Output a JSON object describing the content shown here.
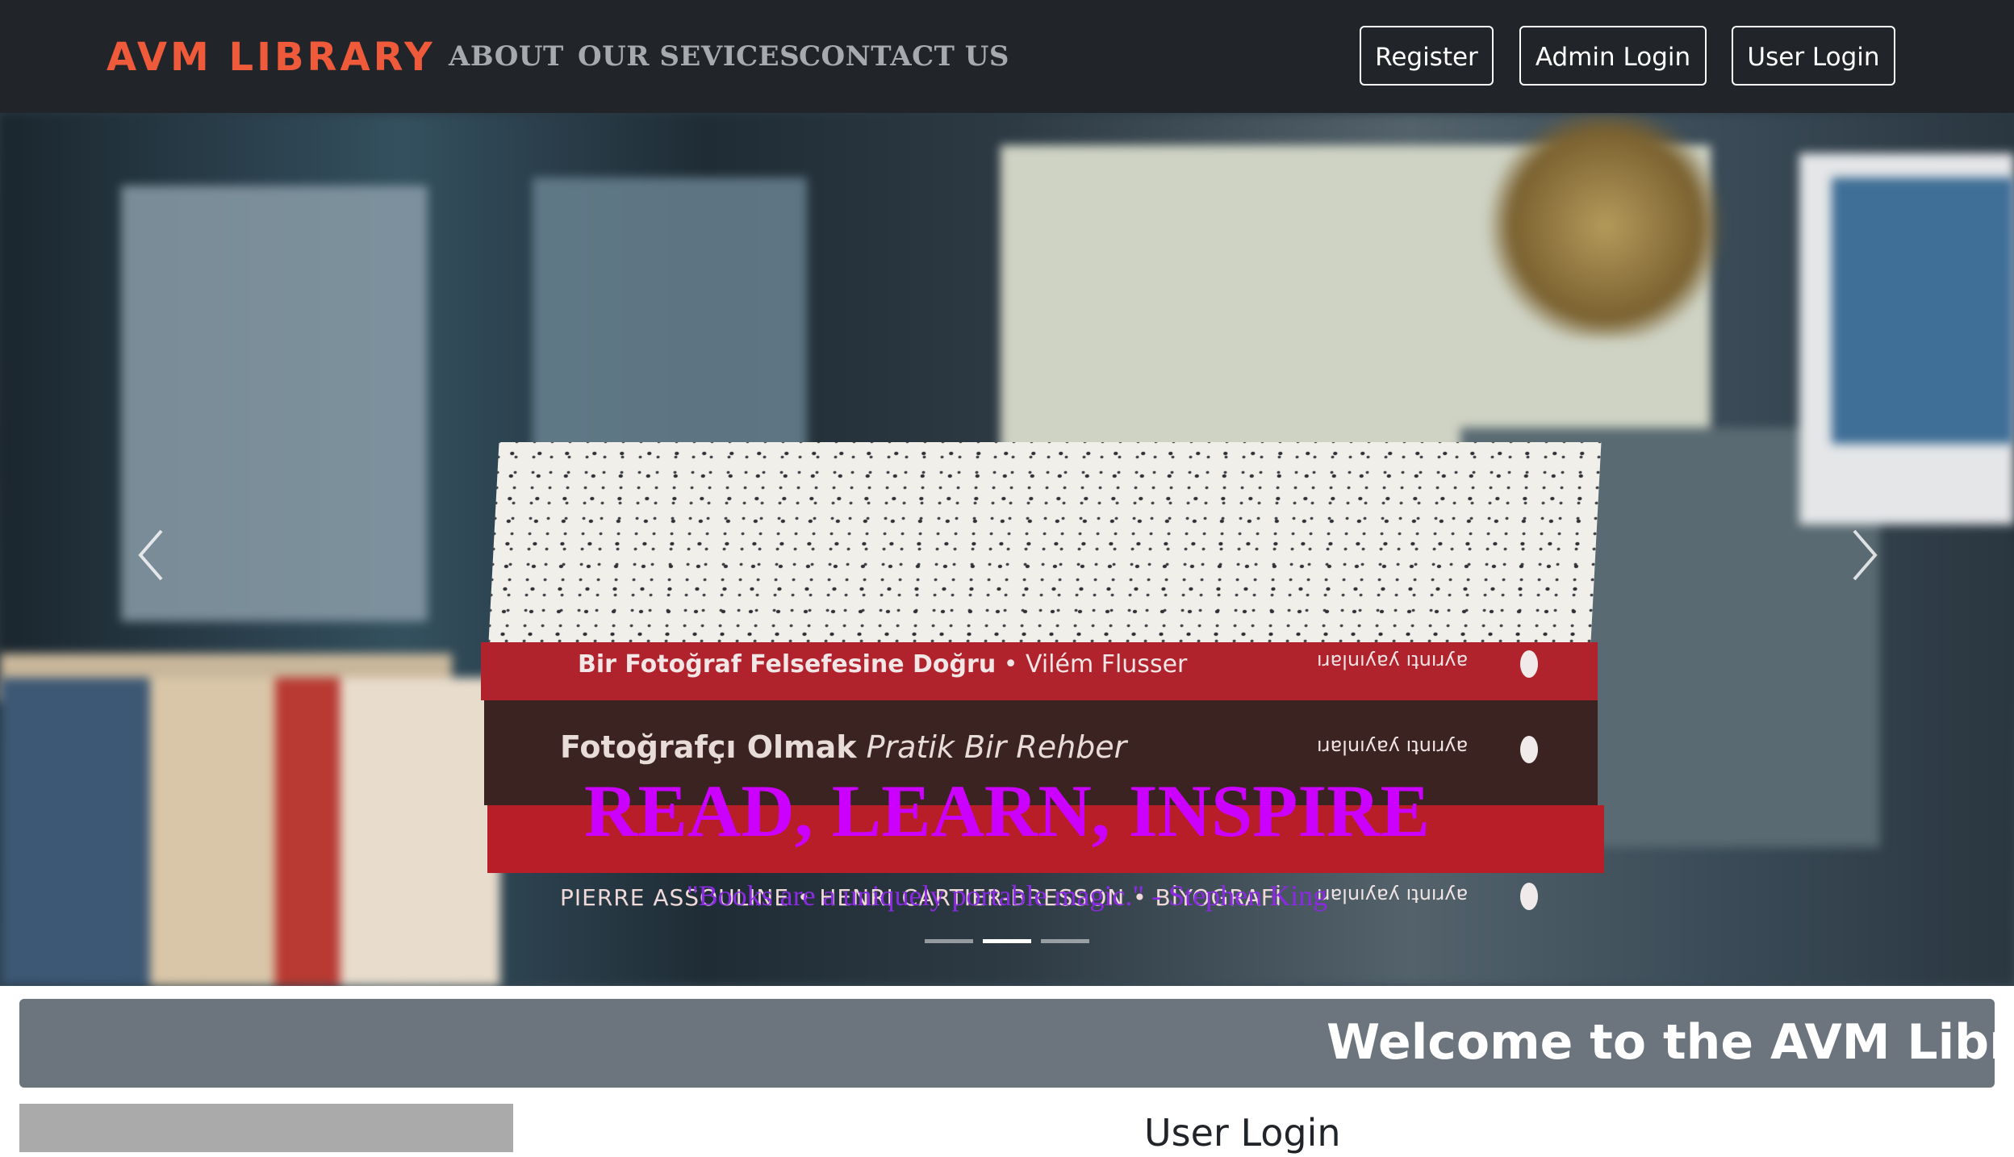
{
  "navbar": {
    "brand": "AVM LIBRARY",
    "links": [
      "ABOUT",
      "OUR SEVICES",
      "CONTACT US"
    ],
    "buttons": {
      "register": "Register",
      "admin_login": "Admin Login",
      "user_login": "User Login"
    },
    "brand_color": "#ee5a3a",
    "background": "#212529"
  },
  "hero": {
    "book1": {
      "title": "Bir Fotoğraf Felsefesine Doğru",
      "author": " • Vilém Flusser",
      "publisher": "ayrıntı yayınları"
    },
    "book2": {
      "title": "Fotoğrafçı Olmak",
      "subtitle": "  Pratik Bir Rehber",
      "publisher": "ayrıntı yayınları"
    },
    "book3": {
      "title": "PIERRE ASSOULINE • HENRI CARTIER-BRESSON • BİYOGRAFİ",
      "publisher": "ayrıntı yayınları"
    },
    "caption_title": "READ, LEARN, INSPIRE",
    "caption_quote": "\"Books are a uniquely portable magic.\" - Stephen King",
    "caption_title_color": "#cc00ff",
    "caption_quote_color": "#8a2be2",
    "prev_icon": "chevron-left-icon",
    "next_icon": "chevron-right-icon",
    "active_slide": 2,
    "slide_count": 3
  },
  "welcome": {
    "text": "Welcome to the AVM Library"
  },
  "section": {
    "heading": "User Login"
  }
}
